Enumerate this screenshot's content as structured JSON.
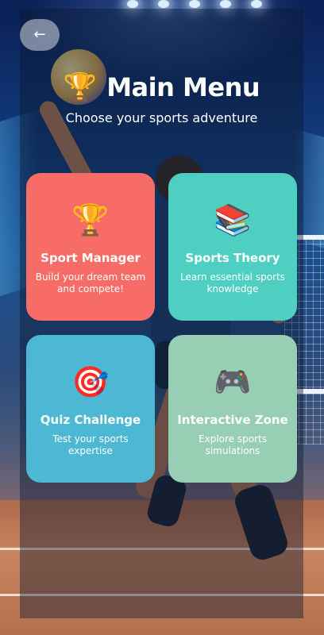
{
  "header": {
    "back_label": "←",
    "title_icon": "🏆",
    "title": "Main Menu",
    "subtitle": "Choose your sports adventure"
  },
  "cards": [
    {
      "icon": "🏆",
      "icon_name": "trophy-icon",
      "title": "Sport Manager",
      "description": "Build your dream team and compete!",
      "color": "#F76C66"
    },
    {
      "icon": "📚",
      "icon_name": "books-icon",
      "title": "Sports Theory",
      "description": "Learn essential sports knowledge",
      "color": "#4FCFC2"
    },
    {
      "icon": "🎯",
      "icon_name": "target-icon",
      "title": "Quiz Challenge",
      "description": "Test your sports expertise",
      "color": "#4DB8D3"
    },
    {
      "icon": "🎮",
      "icon_name": "game-controller-icon",
      "title": "Interactive Zone",
      "description": "Explore sports simulations",
      "color": "#98CFB4"
    }
  ]
}
